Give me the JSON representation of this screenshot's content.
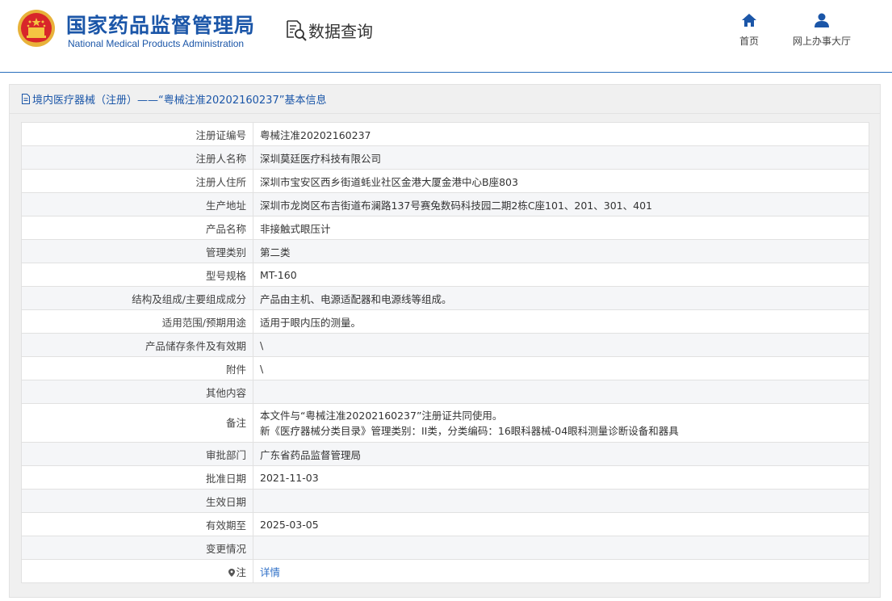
{
  "header": {
    "title_cn": "国家药品监督管理局",
    "title_en": "National Medical Products Administration",
    "query_label": "数据查询",
    "nav": {
      "home": "首页",
      "hall": "网上办事大厅"
    }
  },
  "panel": {
    "title": "境内医疗器械（注册）——“粤械注准20202160237”基本信息"
  },
  "rows": [
    {
      "label": "注册证编号",
      "value": "粤械注准20202160237"
    },
    {
      "label": "注册人名称",
      "value": "深圳莫廷医疗科技有限公司"
    },
    {
      "label": "注册人住所",
      "value": "深圳市宝安区西乡街道蚝业社区金港大厦金港中心B座803"
    },
    {
      "label": "生产地址",
      "value": "深圳市龙岗区布吉街道布澜路137号赛兔数码科技园二期2栋C座101、201、301、401"
    },
    {
      "label": "产品名称",
      "value": "非接触式眼压计"
    },
    {
      "label": "管理类别",
      "value": "第二类"
    },
    {
      "label": "型号规格",
      "value": "MT-160"
    },
    {
      "label": "结构及组成/主要组成成分",
      "value": "产品由主机、电源适配器和电源线等组成。"
    },
    {
      "label": "适用范围/预期用途",
      "value": "适用于眼内压的测量。"
    },
    {
      "label": "产品储存条件及有效期",
      "value": "\\"
    },
    {
      "label": "附件",
      "value": "\\"
    },
    {
      "label": "其他内容",
      "value": ""
    },
    {
      "label": "备注",
      "value": "本文件与“粤械注准20202160237”注册证共同使用。",
      "value2": "新《医疗器械分类目录》管理类别：II类，分类编码：16眼科器械-04眼科测量诊断设备和器具"
    },
    {
      "label": "审批部门",
      "value": "广东省药品监督管理局"
    },
    {
      "label": "批准日期",
      "value": "2021-11-03"
    },
    {
      "label": "生效日期",
      "value": ""
    },
    {
      "label": "有效期至",
      "value": "2025-03-05"
    },
    {
      "label": "变更情况",
      "value": ""
    },
    {
      "label": "注",
      "value": "详情"
    }
  ],
  "colors": {
    "brand_blue": "#1b56a8",
    "link_blue": "#2e6fc7"
  }
}
